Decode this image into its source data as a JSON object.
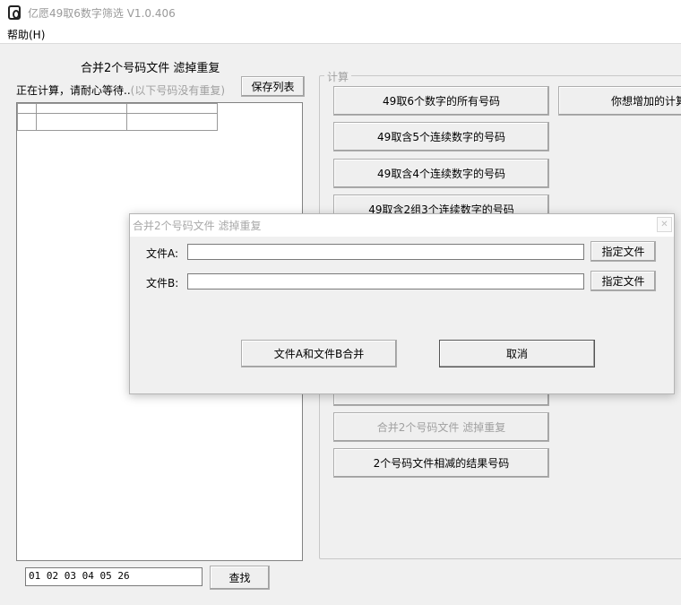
{
  "window": {
    "title": "亿愿49取6数字筛选 V1.0.406"
  },
  "menu": {
    "help": "帮助(H)"
  },
  "left_panel": {
    "heading": "合并2个号码文件 滤掉重复",
    "status": "正在计算，请耐心等待",
    "status_dots": "..",
    "status_note": "(以下号码没有重复)",
    "save_button": "保存列表",
    "search_value": "01 02 03 04 05 26",
    "search_button": "查找"
  },
  "calc_group": {
    "label": "计算",
    "buttons": [
      "49取6个数字的所有号码",
      "49取含5个连续数字的号码",
      "49取含4个连续数字的号码",
      "49取含2组3个连续数字的号码",
      "合并2个号码文件 滤掉重复",
      "2个号码文件相减的结果号码"
    ],
    "extra_button": "你想增加的计算"
  },
  "dialog": {
    "title": "合并2个号码文件 滤掉重复",
    "close_glyph": "✕",
    "file_a_label": "文件A:",
    "file_a_value": "",
    "file_b_label": "文件B:",
    "file_b_value": "",
    "browse_label": "指定文件",
    "merge_button": "文件A和文件B合并",
    "cancel_button": "取消"
  }
}
